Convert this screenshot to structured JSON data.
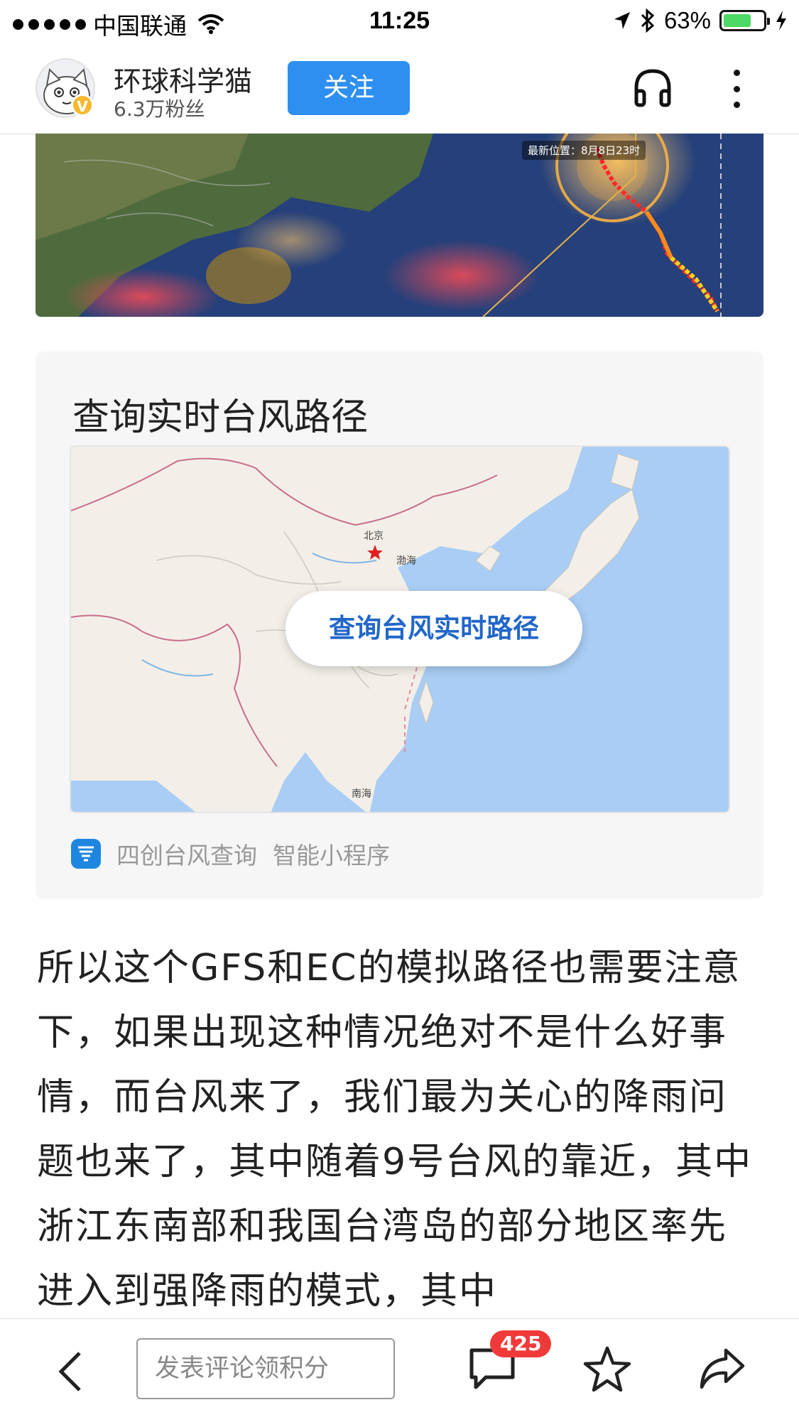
{
  "status_bar": {
    "carrier": "中国联通",
    "time": "11:25",
    "battery": "63%"
  },
  "header": {
    "author_name": "环球科学猫",
    "fans": "6.3万粉丝",
    "follow_label": "关注"
  },
  "satellite_image": {
    "latest_position": "最新位置：8月8日23时"
  },
  "mini_card": {
    "title": "查询实时台风路径",
    "button_label": "查询台风实时路径",
    "map_labels": {
      "beijing": "北京",
      "bohai": "渤海",
      "nanhai": "南海"
    },
    "app_name": "四创台风查询",
    "app_type": "智能小程序"
  },
  "article": {
    "paragraph": "所以这个GFS和EC的模拟路径也需要注意下，如果出现这种情况绝对不是什么好事情，而台风来了，我们最为关心的降雨问题也来了，其中随着9号台风的靠近，其中浙江东南部和我国台湾岛的部分地区率先进入到强降雨的模式，其中"
  },
  "bottom_bar": {
    "comment_placeholder": "发表评论领积分",
    "comment_count": "425"
  },
  "colors": {
    "accent": "#2d8ff0",
    "badge": "#f03a3a",
    "map_button_text": "#2166c9"
  },
  "icons": [
    "back-icon",
    "comment-icon",
    "star-icon",
    "share-icon",
    "headphones-icon",
    "more-icon",
    "wifi-icon",
    "location-icon",
    "bluetooth-icon",
    "charging-icon"
  ]
}
